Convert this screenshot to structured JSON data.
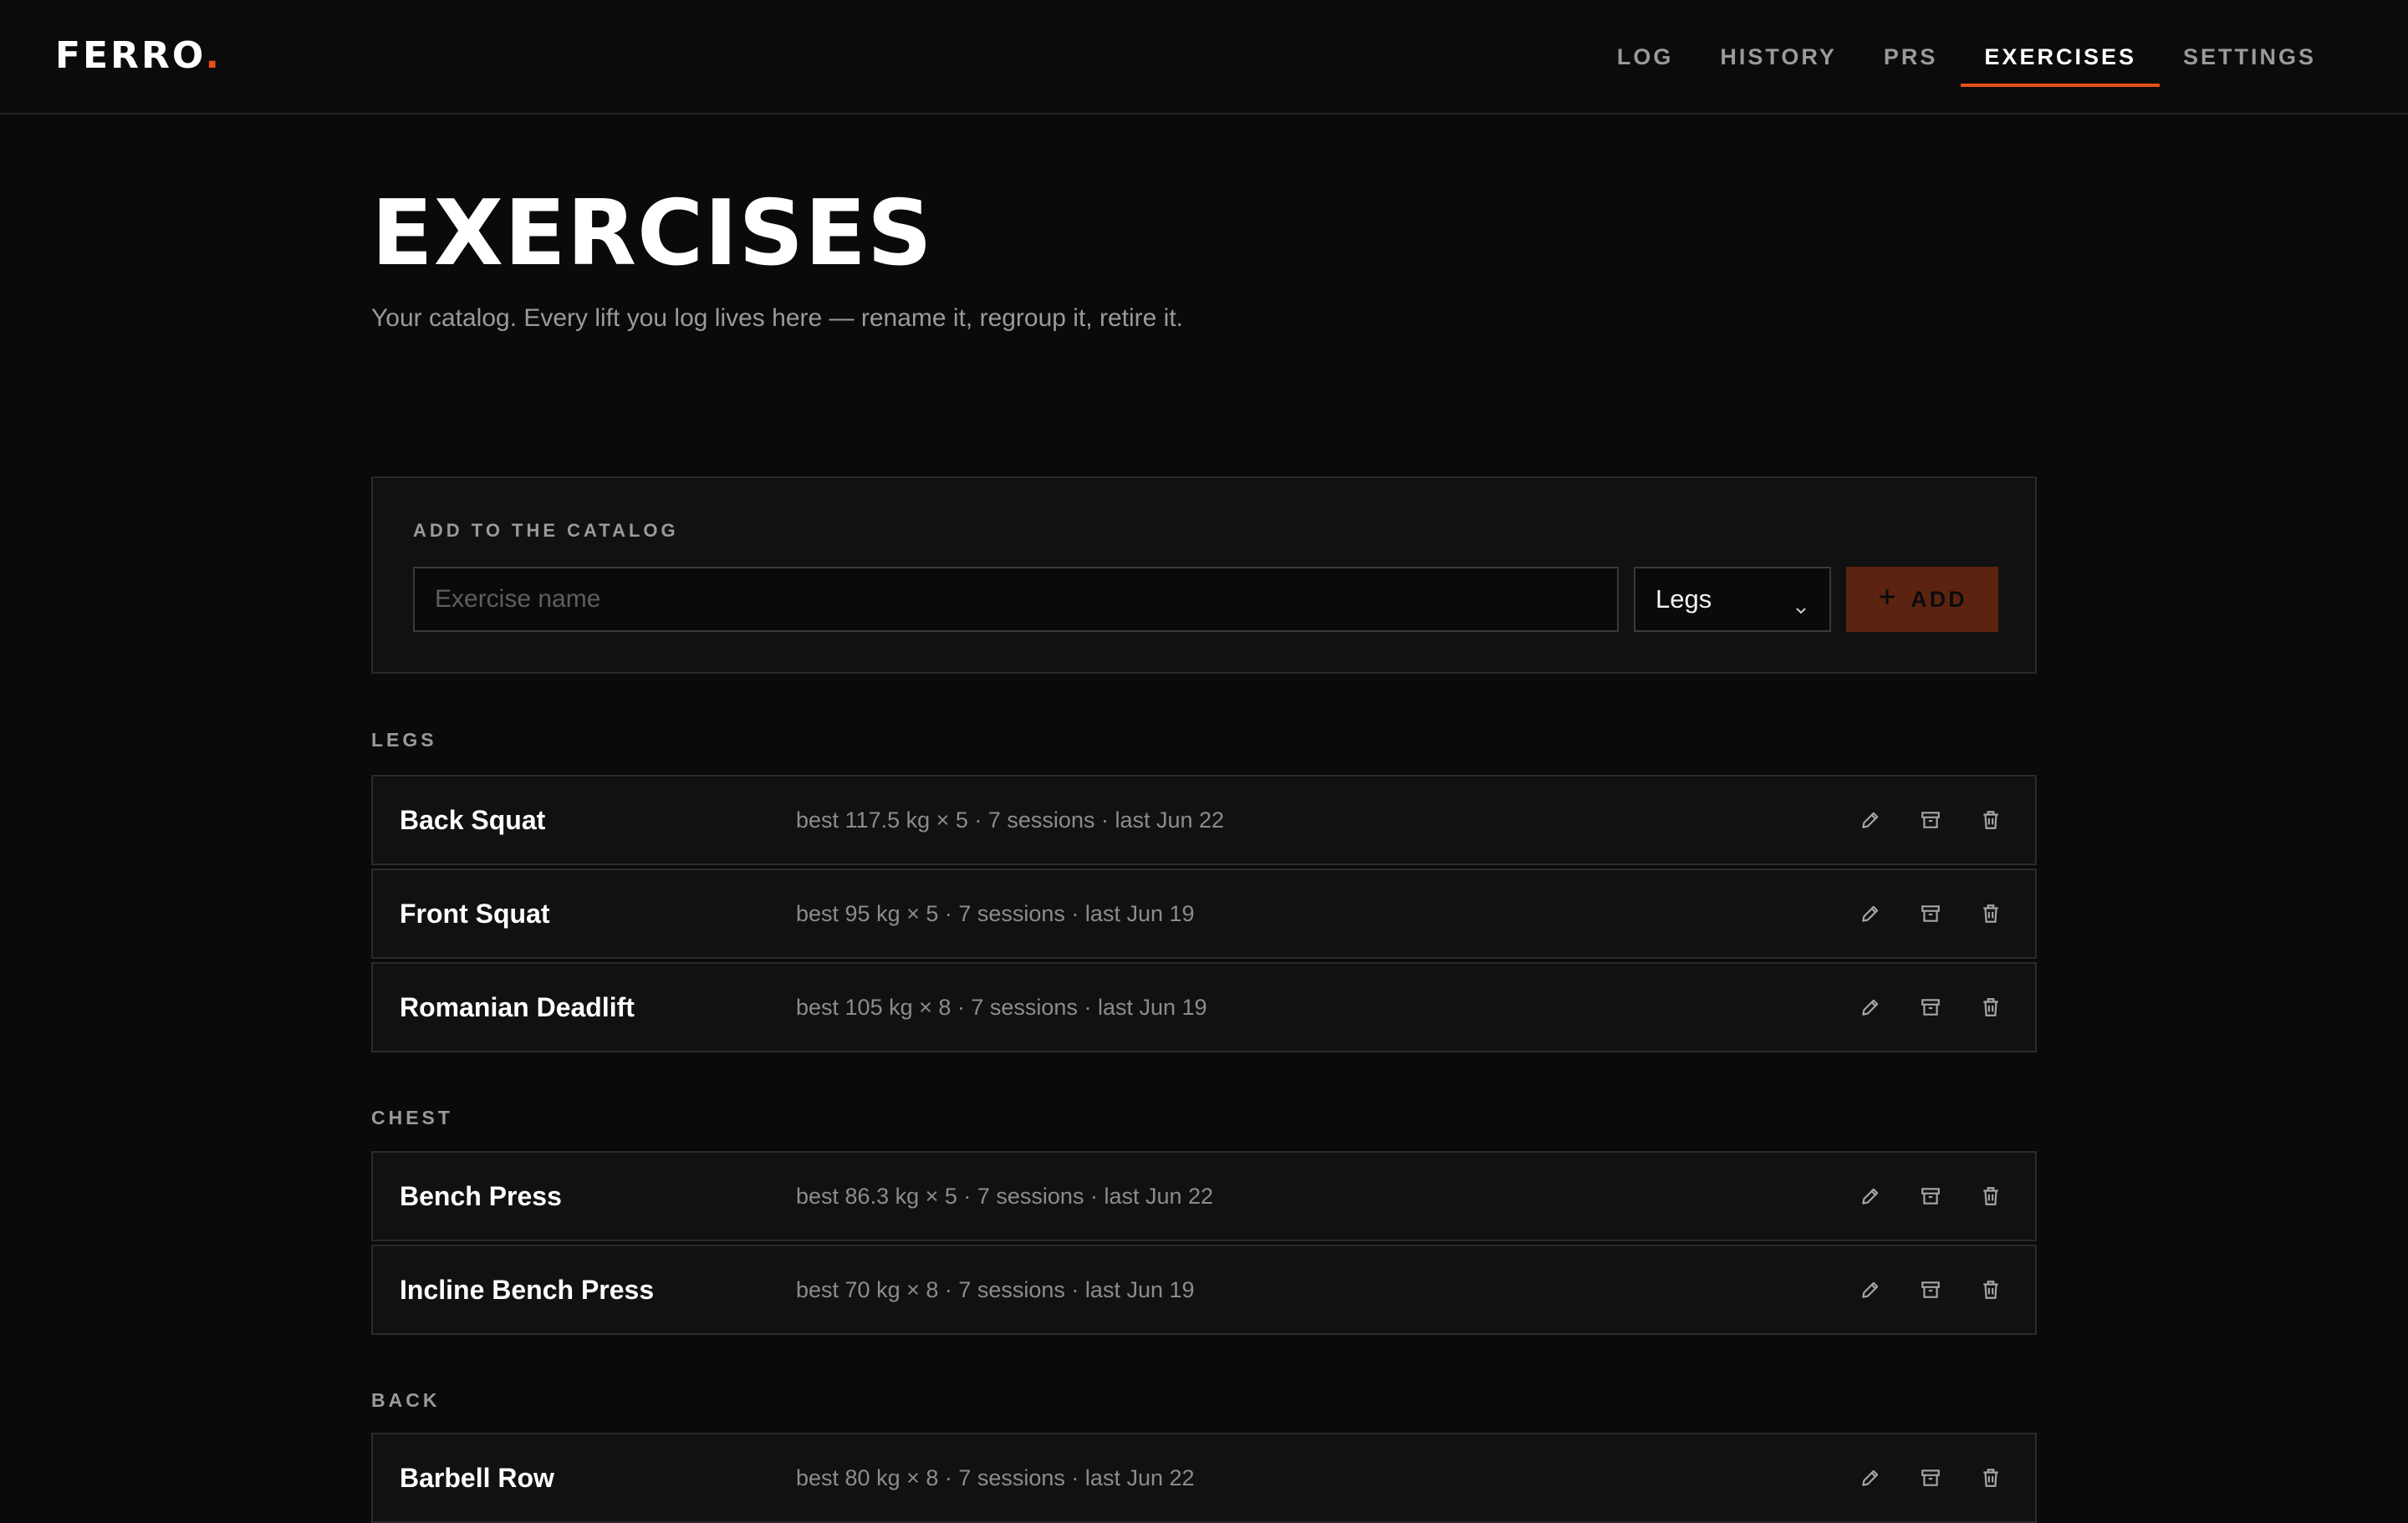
{
  "app": {
    "logo_text": "FERRO",
    "logo_dot": ".",
    "accent_color": "#e5501a"
  },
  "nav": {
    "items": [
      {
        "label": "LOG",
        "active": false
      },
      {
        "label": "HISTORY",
        "active": false
      },
      {
        "label": "PRS",
        "active": false
      },
      {
        "label": "EXERCISES",
        "active": true
      },
      {
        "label": "SETTINGS",
        "active": false
      }
    ]
  },
  "page": {
    "title": "EXERCISES",
    "subtitle": "Your catalog. Every lift you log lives here — rename it, regroup it, retire it."
  },
  "add_form": {
    "label": "ADD TO THE CATALOG",
    "name_placeholder": "Exercise name",
    "name_value": "",
    "group_selected": "Legs",
    "add_label": "ADD",
    "add_icon": "plus-icon"
  },
  "groups": [
    {
      "label": "LEGS",
      "exercises": [
        {
          "name": "Back Squat",
          "stats": "best 117.5 kg × 5 · 7 sessions · last Jun 22"
        },
        {
          "name": "Front Squat",
          "stats": "best 95 kg × 5 · 7 sessions · last Jun 19"
        },
        {
          "name": "Romanian Deadlift",
          "stats": "best 105 kg × 8 · 7 sessions · last Jun 19"
        }
      ]
    },
    {
      "label": "CHEST",
      "exercises": [
        {
          "name": "Bench Press",
          "stats": "best 86.3 kg × 5 · 7 sessions · last Jun 22"
        },
        {
          "name": "Incline Bench Press",
          "stats": "best 70 kg × 8 · 7 sessions · last Jun 19"
        }
      ]
    },
    {
      "label": "BACK",
      "exercises": [
        {
          "name": "Barbell Row",
          "stats": "best 80 kg × 8 · 7 sessions · last Jun 22"
        }
      ]
    }
  ],
  "row_actions": [
    "pencil-icon",
    "archive-icon",
    "trash-icon"
  ]
}
